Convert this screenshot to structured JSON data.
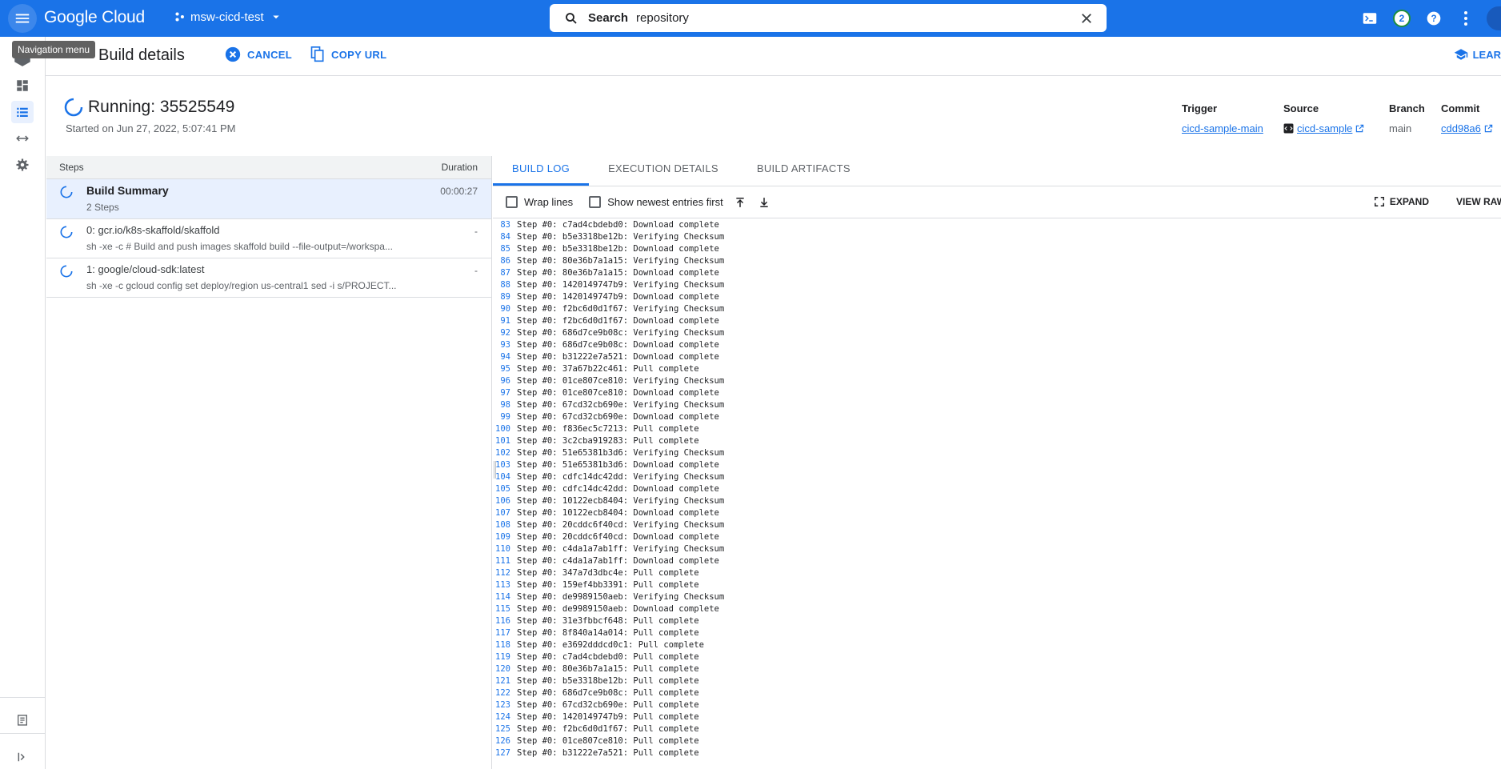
{
  "topbar": {
    "logo": "Google Cloud",
    "project": "msw-cicd-test",
    "search_label": "Search",
    "search_value": "repository",
    "notification_count": "2"
  },
  "tooltip": "Navigation menu",
  "header": {
    "title": "Build details",
    "cancel": "CANCEL",
    "copy_url": "COPY URL",
    "learn": "LEAR"
  },
  "build": {
    "title": "Running: 35525549",
    "started": "Started on Jun 27, 2022, 5:07:41 PM",
    "trigger_label": "Trigger",
    "trigger_value": "cicd-sample-main",
    "source_label": "Source",
    "source_value": "cicd-sample",
    "branch_label": "Branch",
    "branch_value": "main",
    "commit_label": "Commit",
    "commit_value": "cdd98a6"
  },
  "steps": {
    "header_steps": "Steps",
    "header_duration": "Duration",
    "items": [
      {
        "title": "Build Summary",
        "sub": "2 Steps",
        "duration": "00:00:27"
      },
      {
        "title": "0: gcr.io/k8s-skaffold/skaffold",
        "sub": "sh -xe -c # Build and push images skaffold build --file-output=/workspa...",
        "duration": "-"
      },
      {
        "title": "1: google/cloud-sdk:latest",
        "sub": "sh -xe -c gcloud config set deploy/region us-central1 sed -i s/PROJECT...",
        "duration": "-"
      }
    ]
  },
  "log": {
    "tabs": [
      "BUILD LOG",
      "EXECUTION DETAILS",
      "BUILD ARTIFACTS"
    ],
    "wrap_lines": "Wrap lines",
    "show_newest": "Show newest entries first",
    "expand": "EXPAND",
    "view_raw": "VIEW RAW",
    "lines": [
      {
        "n": "83",
        "t": "Step #0: c7ad4cbdebd0: Download complete"
      },
      {
        "n": "84",
        "t": "Step #0: b5e3318be12b: Verifying Checksum"
      },
      {
        "n": "85",
        "t": "Step #0: b5e3318be12b: Download complete"
      },
      {
        "n": "86",
        "t": "Step #0: 80e36b7a1a15: Verifying Checksum"
      },
      {
        "n": "87",
        "t": "Step #0: 80e36b7a1a15: Download complete"
      },
      {
        "n": "88",
        "t": "Step #0: 1420149747b9: Verifying Checksum"
      },
      {
        "n": "89",
        "t": "Step #0: 1420149747b9: Download complete"
      },
      {
        "n": "90",
        "t": "Step #0: f2bc6d0d1f67: Verifying Checksum"
      },
      {
        "n": "91",
        "t": "Step #0: f2bc6d0d1f67: Download complete"
      },
      {
        "n": "92",
        "t": "Step #0: 686d7ce9b08c: Verifying Checksum"
      },
      {
        "n": "93",
        "t": "Step #0: 686d7ce9b08c: Download complete"
      },
      {
        "n": "94",
        "t": "Step #0: b31222e7a521: Download complete"
      },
      {
        "n": "95",
        "t": "Step #0: 37a67b22c461: Pull complete"
      },
      {
        "n": "96",
        "t": "Step #0: 01ce807ce810: Verifying Checksum"
      },
      {
        "n": "97",
        "t": "Step #0: 01ce807ce810: Download complete"
      },
      {
        "n": "98",
        "t": "Step #0: 67cd32cb690e: Verifying Checksum"
      },
      {
        "n": "99",
        "t": "Step #0: 67cd32cb690e: Download complete"
      },
      {
        "n": "100",
        "t": "Step #0: f836ec5c7213: Pull complete"
      },
      {
        "n": "101",
        "t": "Step #0: 3c2cba919283: Pull complete"
      },
      {
        "n": "102",
        "t": "Step #0: 51e65381b3d6: Verifying Checksum"
      },
      {
        "n": "103",
        "t": "Step #0: 51e65381b3d6: Download complete"
      },
      {
        "n": "104",
        "t": "Step #0: cdfc14dc42dd: Verifying Checksum"
      },
      {
        "n": "105",
        "t": "Step #0: cdfc14dc42dd: Download complete"
      },
      {
        "n": "106",
        "t": "Step #0: 10122ecb8404: Verifying Checksum"
      },
      {
        "n": "107",
        "t": "Step #0: 10122ecb8404: Download complete"
      },
      {
        "n": "108",
        "t": "Step #0: 20cddc6f40cd: Verifying Checksum"
      },
      {
        "n": "109",
        "t": "Step #0: 20cddc6f40cd: Download complete"
      },
      {
        "n": "110",
        "t": "Step #0: c4da1a7ab1ff: Verifying Checksum"
      },
      {
        "n": "111",
        "t": "Step #0: c4da1a7ab1ff: Download complete"
      },
      {
        "n": "112",
        "t": "Step #0: 347a7d3dbc4e: Pull complete"
      },
      {
        "n": "113",
        "t": "Step #0: 159ef4bb3391: Pull complete"
      },
      {
        "n": "114",
        "t": "Step #0: de9989150aeb: Verifying Checksum"
      },
      {
        "n": "115",
        "t": "Step #0: de9989150aeb: Download complete"
      },
      {
        "n": "116",
        "t": "Step #0: 31e3fbbcf648: Pull complete"
      },
      {
        "n": "117",
        "t": "Step #0: 8f840a14a014: Pull complete"
      },
      {
        "n": "118",
        "t": "Step #0: e3692dddcd0c1: Pull complete"
      },
      {
        "n": "119",
        "t": "Step #0: c7ad4cbdebd0: Pull complete"
      },
      {
        "n": "120",
        "t": "Step #0: 80e36b7a1a15: Pull complete"
      },
      {
        "n": "121",
        "t": "Step #0: b5e3318be12b: Pull complete"
      },
      {
        "n": "122",
        "t": "Step #0: 686d7ce9b08c: Pull complete"
      },
      {
        "n": "123",
        "t": "Step #0: 67cd32cb690e: Pull complete"
      },
      {
        "n": "124",
        "t": "Step #0: 1420149747b9: Pull complete"
      },
      {
        "n": "125",
        "t": "Step #0: f2bc6d0d1f67: Pull complete"
      },
      {
        "n": "126",
        "t": "Step #0: 01ce807ce810: Pull complete"
      },
      {
        "n": "127",
        "t": "Step #0: b31222e7a521: Pull complete"
      }
    ]
  }
}
